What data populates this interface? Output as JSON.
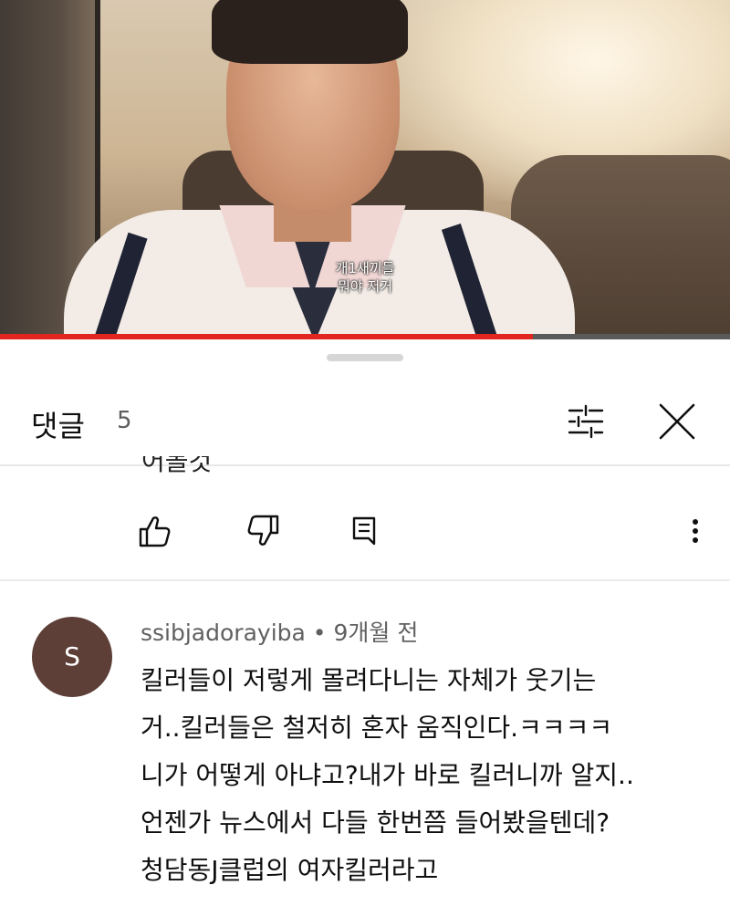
{
  "video": {
    "subtitle_lines": [
      "개1새끼들",
      "뭐야 저거"
    ],
    "progress_fraction": 0.73,
    "colors": {
      "progress_fill": "#e0261f",
      "progress_track": "#5a5a5a"
    }
  },
  "comments_panel": {
    "title": "댓글",
    "count": "5",
    "icons": {
      "filter": "sort-filter-icon",
      "close": "close-icon"
    },
    "previous_comment": {
      "cut_text": "어볼것",
      "actions": {
        "like": "thumbs-up-icon",
        "dislike": "thumbs-down-icon",
        "reply": "reply-icon",
        "more": "more-vert-icon"
      }
    },
    "comment": {
      "avatar_letter": "S",
      "author": "ssibjadorayiba",
      "separator": "•",
      "time": "9개월 전",
      "lines": [
        "킬러들이 저렇게 몰려다니는 자체가 웃기는",
        "거..킬러들은 철저히 혼자 움직인다.ㅋㅋㅋㅋ",
        "니가 어떻게 아냐고?내가 바로 킬러니까 알지..",
        "언젠가 뉴스에서 다들 한번쯤 들어봤을텐데?",
        "청담동J클럽의 여자킬러라고"
      ],
      "colors": {
        "avatar_bg": "#5d3f38"
      }
    }
  }
}
